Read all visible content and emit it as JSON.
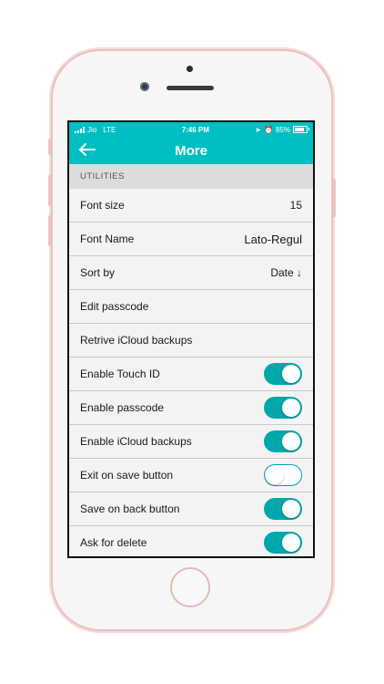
{
  "status_bar": {
    "carrier": "Jio",
    "network": "LTE",
    "time": "7:46 PM",
    "battery": "85%",
    "battery_level": 0.85
  },
  "nav": {
    "title": "More",
    "back_icon": "arrow-left-icon"
  },
  "section": {
    "title": "UTILITIES"
  },
  "rows": [
    {
      "label": "Font size",
      "value": "15"
    },
    {
      "label": "Font Name",
      "value": "Lato-Regul"
    },
    {
      "label": "Sort by",
      "value": "Date ↓"
    },
    {
      "label": "Edit passcode"
    },
    {
      "label": "Retrive iCloud backups"
    },
    {
      "label": "Enable Touch ID",
      "toggle": true
    },
    {
      "label": "Enable passcode",
      "toggle": true
    },
    {
      "label": "Enable iCloud backups",
      "toggle": true
    },
    {
      "label": "Exit on save button",
      "toggle": false
    },
    {
      "label": "Save on back button",
      "toggle": true
    },
    {
      "label": "Ask for delete",
      "toggle": true
    }
  ],
  "colors": {
    "accent": "#00bfc4",
    "toggle_on": "#00a7ab",
    "row_background": "#f3f3f3",
    "section_background": "#dcdcdc"
  }
}
